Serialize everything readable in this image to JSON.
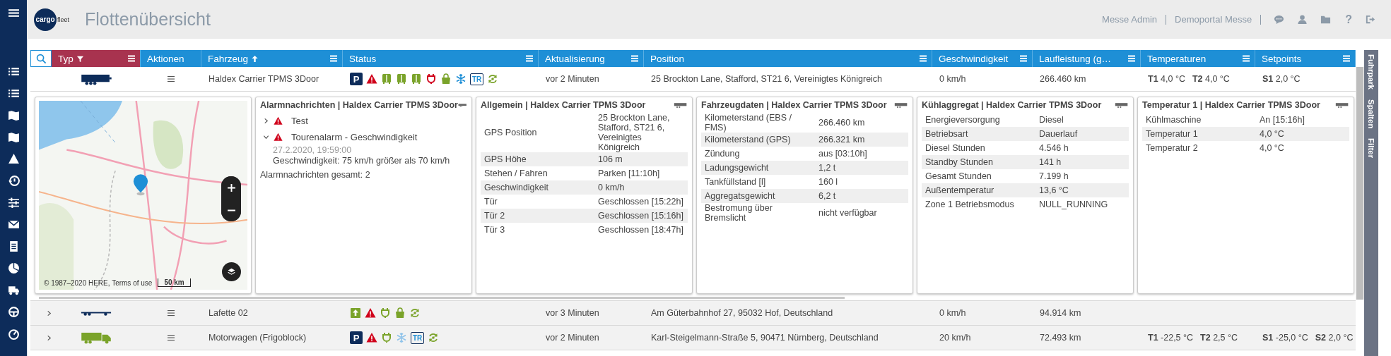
{
  "header": {
    "logo": {
      "primary": "cargo",
      "secondary": "fleet"
    },
    "title": "Flottenübersicht",
    "user": "Messe Admin",
    "portal": "Demoportal Messe",
    "help": "?"
  },
  "table": {
    "columns": [
      {
        "label": "Typ",
        "filter_active": true,
        "sorted": false,
        "has_menu": true
      },
      {
        "label": "Aktionen",
        "filter_active": false,
        "sorted": false,
        "has_menu": false
      },
      {
        "label": "Fahrzeug",
        "filter_active": false,
        "sorted": true,
        "has_menu": true
      },
      {
        "label": "Status",
        "filter_active": false,
        "sorted": false,
        "has_menu": true
      },
      {
        "label": "Aktualisierung",
        "filter_active": false,
        "sorted": false,
        "has_menu": true
      },
      {
        "label": "Position",
        "filter_active": false,
        "sorted": false,
        "has_menu": true
      },
      {
        "label": "Geschwindigkeit",
        "filter_active": false,
        "sorted": false,
        "has_menu": true
      },
      {
        "label": "Laufleistung (g…",
        "filter_active": false,
        "sorted": false,
        "has_menu": true
      },
      {
        "label": "Temperaturen",
        "filter_active": false,
        "sorted": false,
        "has_menu": true
      },
      {
        "label": "Setpoints",
        "filter_active": false,
        "sorted": false,
        "has_menu": true
      }
    ],
    "rows": [
      {
        "expanded": true,
        "kind": "trailer",
        "name": "Haldex Carrier TPMS 3Door",
        "status": [
          {
            "kind": "parking",
            "label": "P"
          },
          {
            "kind": "alarm"
          },
          {
            "kind": "door"
          },
          {
            "kind": "door"
          },
          {
            "kind": "door"
          },
          {
            "kind": "plug",
            "color": "#d0021b"
          },
          {
            "kind": "bag"
          },
          {
            "kind": "snowflake",
            "color": "#1e8fd6"
          },
          {
            "kind": "badge",
            "label": "TR"
          },
          {
            "kind": "refresh"
          }
        ],
        "updated": "vor 2 Minuten",
        "position": "25 Brockton Lane, Stafford, ST21 6, Vereinigtes Königreich",
        "speed": "0 km/h",
        "mileage": "266.460 km",
        "temperatures": [
          {
            "label": "T1",
            "value": "4,0 °C"
          },
          {
            "label": "T2",
            "value": "4,0 °C"
          }
        ],
        "setpoints": [
          {
            "label": "S1",
            "value": "2,0 °C"
          }
        ]
      },
      {
        "expanded": false,
        "kind": "lowloader",
        "name": "Lafette 02",
        "status": [
          {
            "kind": "upload"
          },
          {
            "kind": "alarm"
          },
          {
            "kind": "plug",
            "color": "#7aa32a"
          },
          {
            "kind": "bag"
          },
          {
            "kind": "refresh"
          }
        ],
        "updated": "vor 3 Minuten",
        "position": "Am Güterbahnhof 27, 95032 Hof, Deutschland",
        "speed": "0 km/h",
        "mileage": "94.914 km"
      },
      {
        "expanded": false,
        "kind": "truck",
        "name": "Motorwagen (Frigoblock)",
        "status": [
          {
            "kind": "parking",
            "label": "P"
          },
          {
            "kind": "alarm"
          },
          {
            "kind": "plug",
            "color": "#7aa32a"
          },
          {
            "kind": "snowflake",
            "color": "#8fc3ea"
          },
          {
            "kind": "badge",
            "label": "TR"
          },
          {
            "kind": "refresh"
          }
        ],
        "updated": "vor 2 Minuten",
        "position": "Karl-Steigelmann-Straße 5, 90471 Nürnberg, Deutschland",
        "speed": "20 km/h",
        "mileage": "72.493 km",
        "temperatures": [
          {
            "label": "T1",
            "value": "-22,5 °C"
          },
          {
            "label": "T2",
            "value": "2,5 °C"
          }
        ],
        "setpoints": [
          {
            "label": "S1",
            "value": "-25,0 °C"
          },
          {
            "label": "S2",
            "value": "2,0 °C"
          }
        ]
      }
    ]
  },
  "detail": {
    "map": {
      "copyright": "© 1987–2020 HERE, Terms of use",
      "scale": "50 km"
    },
    "alarms": {
      "title": "Alarmnachrichten | Haldex Carrier TPMS 3Door",
      "items": [
        {
          "title": "Test",
          "expanded": false
        },
        {
          "title": "Tourenalarm - Geschwindigkeit",
          "expanded": true,
          "time": "27.2.2020, 19:59:00",
          "message": "Geschwindigkeit: 75 km/h größer als 70 km/h"
        }
      ],
      "total": "Alarmnachrichten gesamt: 2"
    },
    "cards": [
      {
        "title": "Allgemein | Haldex Carrier TPMS 3Door",
        "rows": [
          {
            "label": "GPS Position",
            "value": "25 Brockton Lane, Stafford, ST21 6, Vereinigtes Königreich"
          },
          {
            "label": "GPS Höhe",
            "value": "106 m"
          },
          {
            "label": "Stehen / Fahren",
            "value": "Parken [11:10h]"
          },
          {
            "label": "Geschwindigkeit",
            "value": "0 km/h"
          },
          {
            "label": "Tür",
            "value": "Geschlossen [15:22h]"
          },
          {
            "label": "Tür 2",
            "value": "Geschlossen [15:16h]"
          },
          {
            "label": "Tür 3",
            "value": "Geschlossen [18:47h]"
          }
        ]
      },
      {
        "title": "Fahrzeugdaten | Haldex Carrier TPMS 3Door",
        "rows": [
          {
            "label": "Kilometerstand (EBS / FMS)",
            "value": "266.460 km"
          },
          {
            "label": "Kilometerstand (GPS)",
            "value": "266.321 km"
          },
          {
            "label": "Zündung",
            "value": "aus [03:10h]"
          },
          {
            "label": "Ladungsgewicht",
            "value": "1,2 t"
          },
          {
            "label": "Tankfüllstand [l]",
            "value": "160 l"
          },
          {
            "label": "Aggregatsgewicht",
            "value": "6,2 t"
          },
          {
            "label": "Bestromung über Bremslicht",
            "value": "nicht verfügbar"
          }
        ]
      },
      {
        "title": "Kühlaggregat | Haldex Carrier TPMS 3Door",
        "rows": [
          {
            "label": "Energieversorgung",
            "value": "Diesel"
          },
          {
            "label": "Betriebsart",
            "value": "Dauerlauf"
          },
          {
            "label": "Diesel Stunden",
            "value": "4.546 h"
          },
          {
            "label": "Standby Stunden",
            "value": "141 h"
          },
          {
            "label": "Gesamt Stunden",
            "value": "7.199 h"
          },
          {
            "label": "Außentemperatur",
            "value": "13,6 °C"
          },
          {
            "label": "Zone 1 Betriebsmodus",
            "value": "NULL_RUNNING"
          }
        ]
      },
      {
        "title": "Temperatur 1 | Haldex Carrier TPMS 3Door",
        "rows": [
          {
            "label": "Kühlmaschine",
            "value": "An [15:16h]"
          },
          {
            "label": "Temperatur 1",
            "value": "4,0 °C"
          },
          {
            "label": "Temperatur 2",
            "value": "4,0 °C"
          }
        ]
      }
    ]
  },
  "side_tabs": [
    {
      "label": "Fuhrpark"
    },
    {
      "label": "Spalten"
    },
    {
      "label": "Filter"
    }
  ]
}
